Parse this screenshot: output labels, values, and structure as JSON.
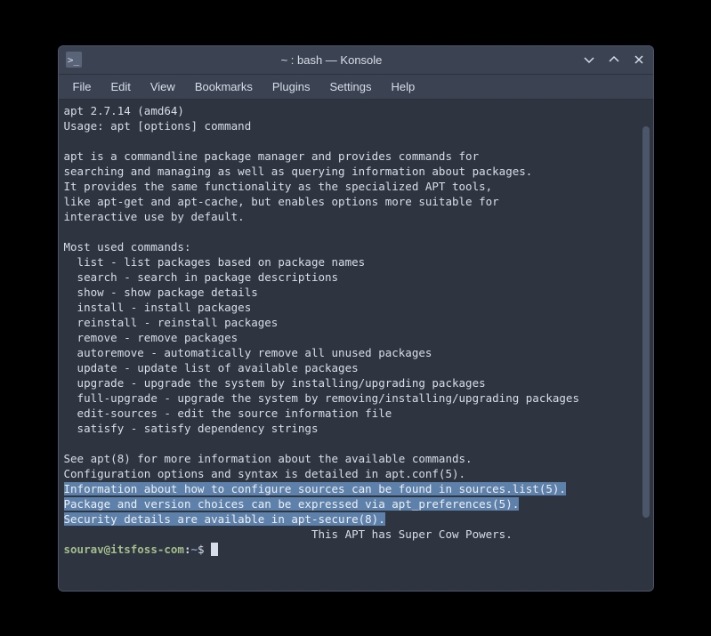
{
  "window": {
    "title": "~ : bash — Konsole",
    "icon_glyph": ">_"
  },
  "menubar": {
    "items": [
      "File",
      "Edit",
      "View",
      "Bookmarks",
      "Plugins",
      "Settings",
      "Help"
    ]
  },
  "terminal": {
    "lines": [
      "apt 2.7.14 (amd64)",
      "Usage: apt [options] command",
      "",
      "apt is a commandline package manager and provides commands for",
      "searching and managing as well as querying information about packages.",
      "It provides the same functionality as the specialized APT tools,",
      "like apt-get and apt-cache, but enables options more suitable for",
      "interactive use by default.",
      "",
      "Most used commands:",
      "  list - list packages based on package names",
      "  search - search in package descriptions",
      "  show - show package details",
      "  install - install packages",
      "  reinstall - reinstall packages",
      "  remove - remove packages",
      "  autoremove - automatically remove all unused packages",
      "  update - update list of available packages",
      "  upgrade - upgrade the system by installing/upgrading packages",
      "  full-upgrade - upgrade the system by removing/installing/upgrading packages",
      "  edit-sources - edit the source information file",
      "  satisfy - satisfy dependency strings",
      "",
      "See apt(8) for more information about the available commands.",
      "Configuration options and syntax is detailed in apt.conf(5).",
      "Information about how to configure sources can be found in sources.list(5).",
      "Package and version choices can be expressed via apt_preferences(5).",
      "Security details are available in apt-secure(8).",
      "                                     This APT has Super Cow Powers."
    ],
    "selected_line_indexes": [
      25,
      26,
      27
    ],
    "prompt": {
      "user_host": "sourav@itsfoss-com",
      "separator": ":",
      "path": "~",
      "symbol": "$"
    }
  }
}
